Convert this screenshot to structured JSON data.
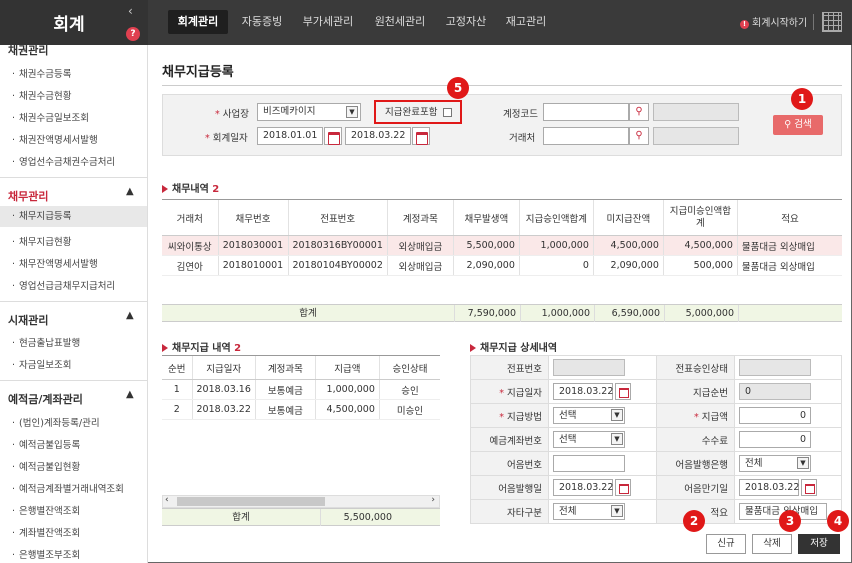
{
  "app": {
    "title": "회계",
    "help_icon": "?"
  },
  "nav": {
    "tabs": [
      "회계관리",
      "자동증빙",
      "부가세관리",
      "원천세관리",
      "고정자산",
      "재고관리"
    ],
    "active": "회계관리",
    "start_link": "회계시작하기"
  },
  "sidebar": {
    "sections": [
      {
        "title": "채권관리",
        "items": [
          "채권수금등록",
          "채권수금현황",
          "채권수금일보조회",
          "채권잔액명세서발행",
          "영업선수금채권수금처리"
        ]
      },
      {
        "title": "채무관리",
        "items": [
          "채무지급등록",
          "채무지급현황",
          "채무잔액명세서발행",
          "영업선급금채무지급처리"
        ],
        "selected": "채무지급등록"
      },
      {
        "title": "시재관리",
        "items": [
          "현금출납표발행",
          "자금일보조회"
        ]
      },
      {
        "title": "예적금/계좌관리",
        "items": [
          "(법인)계좌등록/관리",
          "예적금불입등록",
          "예적금불입현황",
          "예적금계좌별거래내역조회",
          "은행별잔액조회",
          "계좌별잔액조회",
          "은행별조부조회"
        ]
      }
    ]
  },
  "page": {
    "title": "채무지급등록"
  },
  "search": {
    "biz_label": "사업장",
    "biz_value": "비즈메카이지",
    "date_label": "회계일자",
    "date_from": "2018.01.01",
    "date_to": "2018.03.22",
    "include_paid_label": "지급완료포함",
    "account_label": "계정코드",
    "account_value": "",
    "client_label": "거래처",
    "client_value": "",
    "search_button": "검색"
  },
  "debt": {
    "title": "채무내역",
    "count": "2",
    "columns": [
      "거래처",
      "채무번호",
      "전표번호",
      "계정과목",
      "채무발생액",
      "지급승인액합계",
      "미지급잔액",
      "지급미승인액합계",
      "적요"
    ],
    "rows": [
      [
        "씨와이통상",
        "2018030001",
        "20180316BY00001",
        "외상매입금",
        "5,500,000",
        "1,000,000",
        "4,500,000",
        "4,500,000",
        "물품대금 외상매입"
      ],
      [
        "김연아",
        "2018010001",
        "20180104BY00002",
        "외상매입금",
        "2,090,000",
        "0",
        "2,090,000",
        "500,000",
        "물품대금 외상매입"
      ]
    ],
    "sum_label": "합계",
    "sums": [
      "7,590,000",
      "1,000,000",
      "6,590,000",
      "5,000,000"
    ]
  },
  "payments": {
    "title": "채무지급 내역",
    "count": "2",
    "columns": [
      "순번",
      "지급일자",
      "계정과목",
      "지급액",
      "승인상태"
    ],
    "rows": [
      [
        "1",
        "2018.03.16",
        "보통예금",
        "1,000,000",
        "승인"
      ],
      [
        "2",
        "2018.03.22",
        "보통예금",
        "4,500,000",
        "미승인"
      ]
    ],
    "sum_label": "합계",
    "sum": "5,500,000"
  },
  "detail": {
    "title": "채무지급 상세내역",
    "voucher_no_label": "전표번호",
    "voucher_no": "",
    "approval_label": "전표승인상태",
    "approval": "",
    "pay_date_label": "지급일자",
    "pay_date": "2018.03.22",
    "seq_label": "지급순번",
    "seq": "0",
    "method_label": "지급방법",
    "method": "선택",
    "amount_label": "지급액",
    "amount": "0",
    "account_label": "예금계좌번호",
    "account": "선택",
    "fee_label": "수수료",
    "fee": "0",
    "bill_no_label": "어음번호",
    "bill_no": "",
    "bill_bank_label": "어음발행은행",
    "bill_bank": "전체",
    "issue_date_label": "어음발행일",
    "issue_date": "2018.03.22",
    "due_date_label": "어음만기일",
    "due_date": "2018.03.22",
    "other_label": "자타구분",
    "other": "전체",
    "memo_label": "적요",
    "memo": "물품대금 외상매입"
  },
  "actions": {
    "new": "신규",
    "delete": "삭제",
    "save": "저장"
  },
  "callouts": [
    "1",
    "2",
    "3",
    "4",
    "5"
  ],
  "colors": {
    "accent": "#c8283c",
    "callout": "#e01818",
    "topbar": "#3a3a3a",
    "search_button": "#e86a6a",
    "highlight_row": "#fae8e8",
    "sum_row": "#f0f6e4"
  }
}
